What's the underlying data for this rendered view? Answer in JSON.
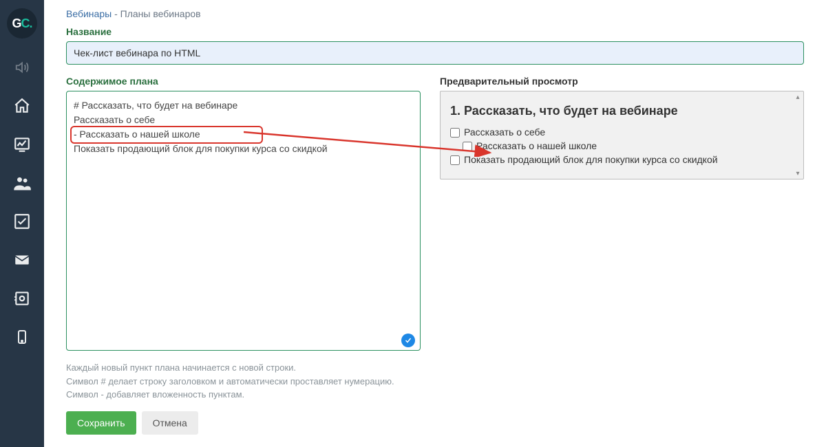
{
  "breadcrumb": {
    "link": "Вебинары",
    "sep": "-",
    "current": "Планы вебинаров"
  },
  "labels": {
    "name": "Название",
    "content": "Содержимое плана",
    "preview": "Предварительный просмотр"
  },
  "form": {
    "name_value": "Чек-лист вебинара по HTML",
    "content_value": "# Рассказать, что будет на вебинаре\nРассказать о себе\n- Рассказать о нашей школе\nПоказать продающий блок для покупки курса со скидкой"
  },
  "help": {
    "line1": "Каждый новый пункт плана начинается с новой строки.",
    "line2": "Символ # делает строку заголовком и автоматически проставляет нумерацию.",
    "line3": "Символ - добавляет вложенность пунктам."
  },
  "buttons": {
    "save": "Сохранить",
    "cancel": "Отмена"
  },
  "preview": {
    "heading": "1. Рассказать, что будет на вебинаре",
    "items": [
      {
        "label": "Рассказать о себе",
        "indent": 0
      },
      {
        "label": "Рассказать о нашей школе",
        "indent": 1
      },
      {
        "label": "Показать продающий блок для покупки курса со скидкой",
        "indent": 0
      }
    ]
  }
}
